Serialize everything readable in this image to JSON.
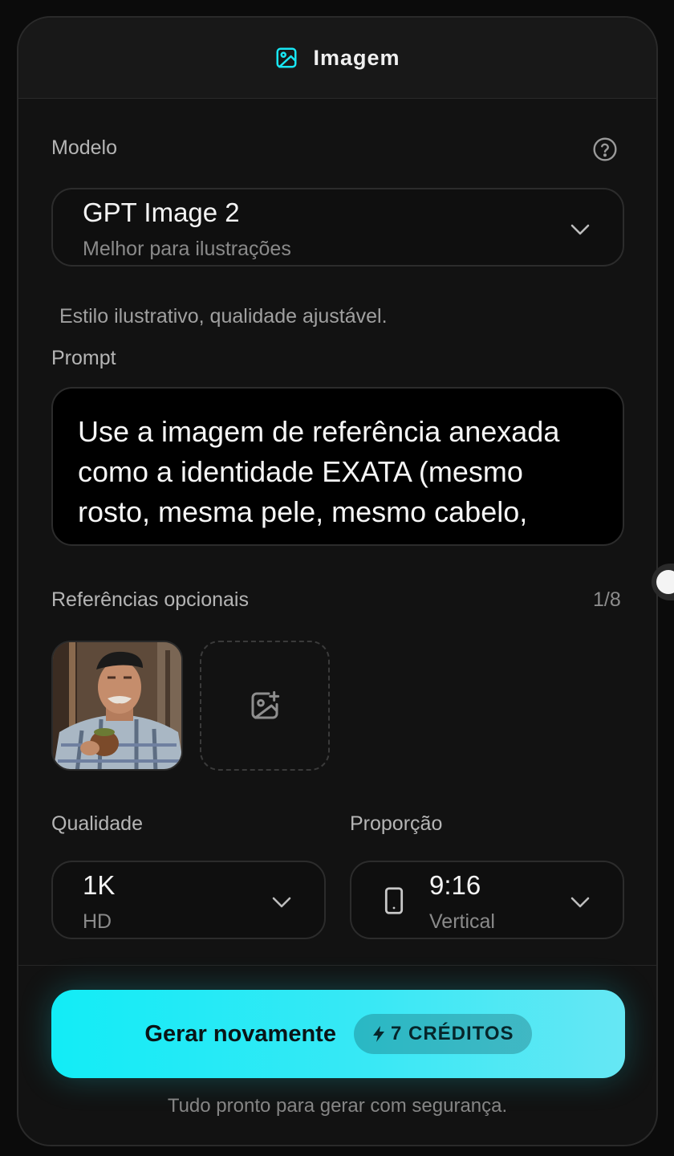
{
  "header": {
    "title": "Imagem",
    "icon": "image-icon"
  },
  "model": {
    "label": "Modelo",
    "selected_name": "GPT Image 2",
    "selected_desc": "Melhor para ilustrações",
    "hint": "Estilo ilustrativo, qualidade ajustável."
  },
  "prompt": {
    "label": "Prompt",
    "value": "Use a imagem de referência anexada como a identidade EXATA (mesmo rosto, mesma pele, mesmo cabelo, mesmos"
  },
  "references": {
    "label": "Referências opcionais",
    "counter": "1/8"
  },
  "quality": {
    "label": "Qualidade",
    "value": "1K",
    "sub": "HD"
  },
  "aspect": {
    "label": "Proporção",
    "value": "9:16",
    "sub": "Vertical"
  },
  "generate": {
    "label": "Gerar novamente",
    "credits": "7 CRÉDITOS"
  },
  "footer": {
    "note": "Tudo pronto para gerar com segurança."
  },
  "colors": {
    "accent": "#12ecf6",
    "panel": "#121212",
    "background": "#0b0b0b"
  }
}
